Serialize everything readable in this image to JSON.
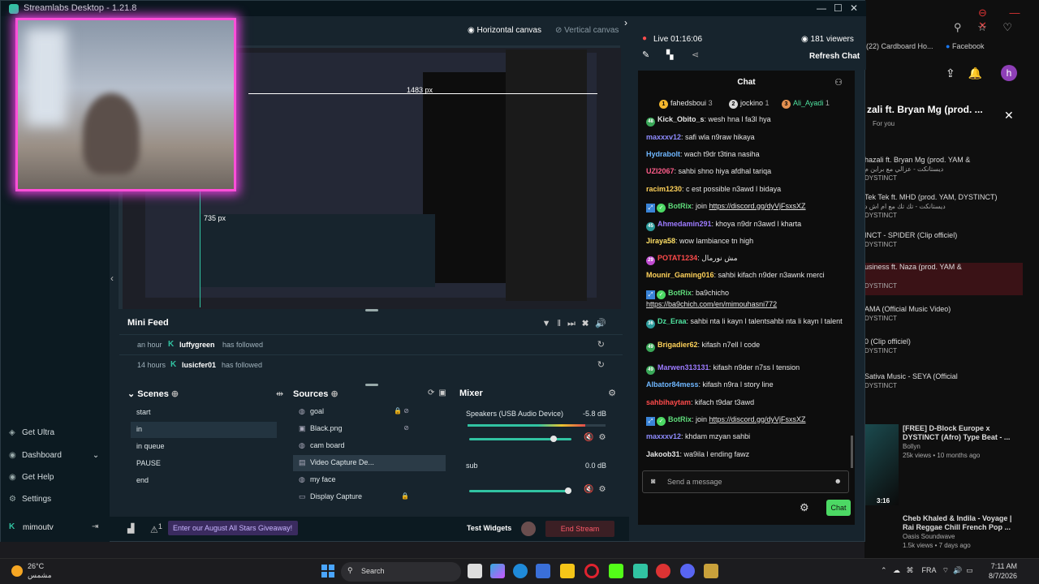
{
  "app": {
    "title": "Streamlabs Desktop - 1.21.8"
  },
  "canvas": {
    "horizontal_label": "Horizontal canvas",
    "vertical_label": "Vertical canvas"
  },
  "preview": {
    "width_label": "1483 px",
    "height_label": "735 px"
  },
  "stream": {
    "live_time": "Live 01:16:06",
    "viewers": "181 viewers",
    "refresh_chat": "Refresh Chat"
  },
  "chat": {
    "title": "Chat",
    "top_users": [
      {
        "rank": "1",
        "name": "fahedsboui",
        "count": "3",
        "color": "#f5b82e"
      },
      {
        "rank": "2",
        "name": "jockino",
        "count": "1",
        "color": "#d9d9d9"
      },
      {
        "rank": "3",
        "name": "Ali_Ayadi",
        "count": "1",
        "color": "#e39050"
      }
    ],
    "messages": [
      {
        "badge": "48",
        "badge_color": "#3aa858",
        "user": "Kick_Obito_s",
        "user_color": "#e6e6e6",
        "text": ": wesh hna l fa3l hya"
      },
      {
        "user": "maxxxv12",
        "user_color": "#8f8cff",
        "text": ": safi wla n9raw hikaya"
      },
      {
        "user": "Hydrabolt",
        "user_color": "#6fb7ff",
        "text": ": wach t9dr t3tina nasiha"
      },
      {
        "user": "UZI2067",
        "user_color": "#ff5d8a",
        "text": ": sahbi shno hiya afdhal tariqa"
      },
      {
        "user": "racim1230",
        "user_color": "#ffd25a",
        "text": ": c est possible n3awd l bidaya"
      },
      {
        "verified": true,
        "user": "BotRix",
        "user_color": "#5fdc7b",
        "text": ": join ",
        "link": "https://discord.gg/dyVjFsxsXZ"
      },
      {
        "badge": "45",
        "badge_color": "#2b9a9a",
        "user": "Ahmedamin291",
        "user_color": "#9d7bff",
        "text": ": khoya n9dr n3awd l kharta"
      },
      {
        "user": "Jiraya58",
        "user_color": "#ffe066",
        "text": ": wow lambiance tn high"
      },
      {
        "badge": "29",
        "badge_color": "#c04bd1",
        "user": "POTAT1234",
        "user_color": "#ff4b4b",
        "text": ": مش نورمال"
      },
      {
        "user": "Mounir_Gaming016",
        "user_color": "#ffd25a",
        "text": ": sahbi kifach n9der n3awnk merci"
      },
      {
        "verified": true,
        "user": "BotRix",
        "user_color": "#5fdc7b",
        "text": ": ba9chicho",
        "link2": "https://ba9chich.com/en/mimouhasni772"
      },
      {
        "badge": "36",
        "badge_color": "#2b9a9a",
        "user": "Dz_Eraa",
        "user_color": "#4fe3a0",
        "text": ": sahbi nta li kayn l talentsahbi nta li kayn l talent"
      },
      {
        "badge": "49",
        "badge_color": "#3aa858",
        "user": "Brigadier62",
        "user_color": "#ffd25a",
        "text": ": kifash n7ell l code"
      },
      {
        "badge": "49",
        "badge_color": "#3aa858",
        "user": "Marwen313131",
        "user_color": "#9d7bff",
        "text": ": kifash n9der n7ss l tension"
      },
      {
        "user": "Albator84mess",
        "user_color": "#6fb7ff",
        "text": ": kifash n9ra l story line"
      },
      {
        "user": "sahbihaytam",
        "user_color": "#ff4b4b",
        "text": ": kifach t9dar t3awd"
      },
      {
        "verified": true,
        "user": "BotRix",
        "user_color": "#5fdc7b",
        "text": ": join ",
        "link": "https://discord.gg/dyVjFsxsXZ"
      },
      {
        "user": "maxxxv12",
        "user_color": "#8f8cff",
        "text": ": khdam mzyan sahbi"
      },
      {
        "user": "Jakoob31",
        "user_color": "#e6e6e6",
        "text": ": wa9ila l ending fawz"
      }
    ],
    "input_placeholder": "Send a message",
    "send_label": "Chat"
  },
  "minifeed": {
    "title": "Mini Feed",
    "items": [
      {
        "time": "an hour",
        "name": "luffygreen",
        "action": "has followed"
      },
      {
        "time": "14 hours",
        "name": "lusicfer01",
        "action": "has followed"
      }
    ]
  },
  "scenes": {
    "title": "Scenes",
    "items": [
      "start",
      "in",
      "in queue",
      "PAUSE",
      "end"
    ],
    "selected": "in"
  },
  "sources": {
    "title": "Sources",
    "items": [
      "goal",
      "Black.png",
      "cam board",
      "Video Capture De...",
      "my face",
      "Display Capture"
    ],
    "selected": "Video Capture De..."
  },
  "mixer": {
    "title": "Mixer",
    "channels": [
      {
        "name": "Speakers (USB Audio Device)",
        "db": "-5.8 dB",
        "level": 0.85
      },
      {
        "name": "sub",
        "db": "0.0 dB",
        "level": 1.0
      }
    ]
  },
  "sidebar": {
    "items": [
      "Get Ultra",
      "Dashboard",
      "Get Help",
      "Settings"
    ],
    "user": "mimoutv"
  },
  "bottombar": {
    "giveaway": "Enter our August All Stars Giveaway!",
    "test_widgets": "Test Widgets",
    "end_stream": "End Stream",
    "alerts_count": "1"
  },
  "browser": {
    "tab_title": "(22) Cardboard Ho...",
    "bookmark": "Facebook",
    "video_title": "zali ft. Bryan Mg (prod. ...",
    "avatar_letter": "h",
    "for_you": "For you",
    "items": [
      {
        "title": "hazali ft. Bryan Mg (prod. YAM &",
        "sub": "ديستانكت - عزالي مع براين م",
        "channel": "DYSTINCT"
      },
      {
        "title": "Tek Tek ft. MHD (prod. YAM, DYSTINCT)",
        "sub": "ديستانكت - تك تك مع ام اش د",
        "channel": "DYSTINCT"
      },
      {
        "title": "INCT - SPIDER (Clip officiel)",
        "channel": "DYSTINCT"
      },
      {
        "title": "usiness ft. Naza (prod. YAM &",
        "channel": "DYSTINCT"
      },
      {
        "title": "AMA (Official Music Video)",
        "channel": "DYSTINCT"
      },
      {
        "title": "0 (Clip officiel)",
        "channel": "DYSTINCT"
      },
      {
        "title": "Sativa Music - SEYA (Official",
        "channel": "DYSTINCT"
      },
      {
        "title": "[FREE] D-Block Europe x DYSTINCT (Afro) Type Beat - ...",
        "channel": "Bollyn",
        "meta": "25k views • 10 months ago"
      },
      {
        "title": "Cheb Khaled & Indila - Voyage | Rai Reggae Chill French Pop ...",
        "channel": "Oasis Soundwave",
        "meta": "1.5k views • 7 days ago",
        "duration": "3:16"
      }
    ]
  },
  "taskbar": {
    "weather_temp": "26°C",
    "weather_desc": "مشمس",
    "search_placeholder": "Search",
    "lang": "FRA",
    "time": "7:11 AM",
    "date": "8/7/2026"
  },
  "colors": {
    "accent": "#31c3a2",
    "chat_button": "#4cd964",
    "webcam_border": "#ff4fd8",
    "end_stream": "#ff5a6a"
  }
}
